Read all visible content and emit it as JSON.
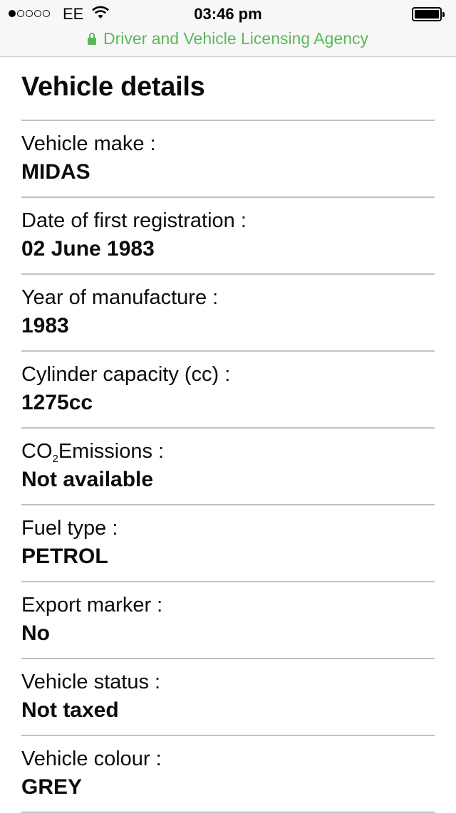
{
  "status_bar": {
    "carrier": "EE",
    "time": "03:46 pm",
    "signal_bars_filled": 1,
    "signal_bars_total": 5,
    "battery_level": 1.0
  },
  "url_bar": {
    "site_name": "Driver and Vehicle Licensing Agency",
    "accent_color": "#5cb85c"
  },
  "page": {
    "title": "Vehicle details"
  },
  "details": [
    {
      "label": "Vehicle make :",
      "value": "MIDAS"
    },
    {
      "label": "Date of first registration :",
      "value": "02 June 1983"
    },
    {
      "label": "Year of manufacture :",
      "value": "1983"
    },
    {
      "label": "Cylinder capacity (cc) :",
      "value": "1275cc"
    },
    {
      "label_prefix": "CO",
      "label_sub": "2",
      "label_suffix": "Emissions :",
      "value": "Not available"
    },
    {
      "label": "Fuel type :",
      "value": "PETROL"
    },
    {
      "label": "Export marker :",
      "value": "No"
    },
    {
      "label": "Vehicle status :",
      "value": "Not taxed"
    },
    {
      "label": "Vehicle colour :",
      "value": "GREY"
    }
  ]
}
